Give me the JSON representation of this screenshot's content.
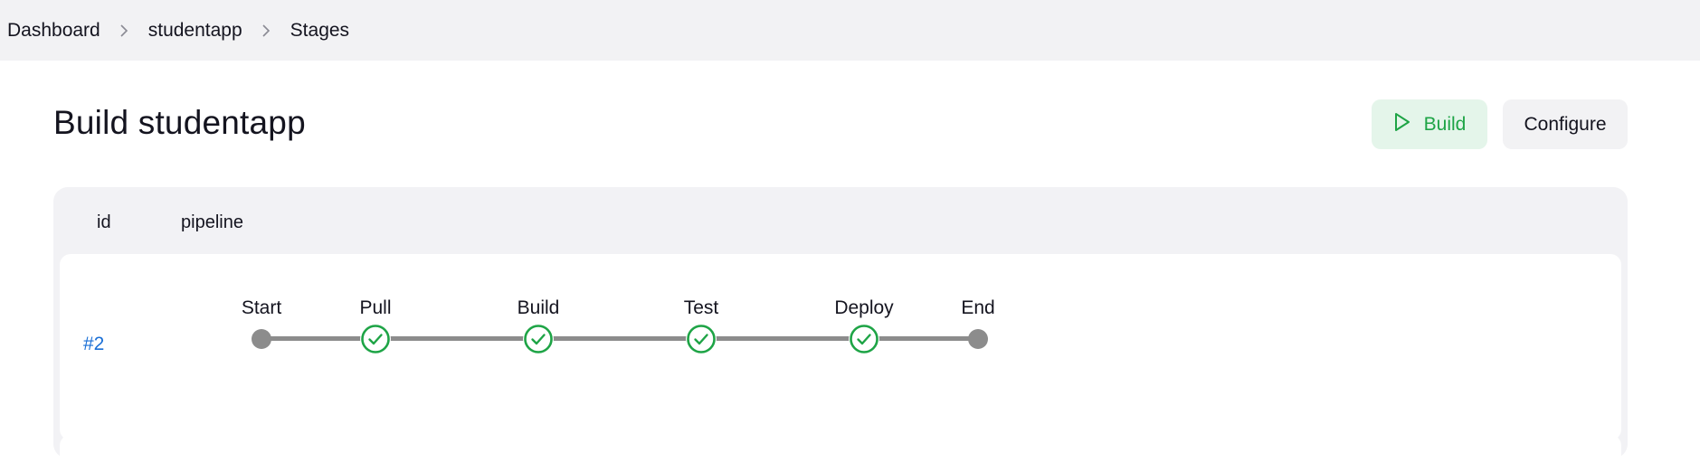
{
  "breadcrumb": {
    "items": [
      {
        "label": "Dashboard"
      },
      {
        "label": "studentapp"
      },
      {
        "label": "Stages"
      }
    ]
  },
  "header": {
    "title": "Build studentapp",
    "build_label": "Build",
    "configure_label": "Configure"
  },
  "table": {
    "columns": [
      "id",
      "pipeline"
    ],
    "rows": [
      {
        "id": "#2",
        "stages": [
          {
            "name": "Start",
            "status": "node"
          },
          {
            "name": "Pull",
            "status": "success"
          },
          {
            "name": "Build",
            "status": "success"
          },
          {
            "name": "Test",
            "status": "success"
          },
          {
            "name": "Deploy",
            "status": "success"
          },
          {
            "name": "End",
            "status": "node"
          }
        ]
      }
    ]
  },
  "colors": {
    "success": "#1ea446",
    "node": "#8c8c8c",
    "link": "#1a6fd6"
  }
}
